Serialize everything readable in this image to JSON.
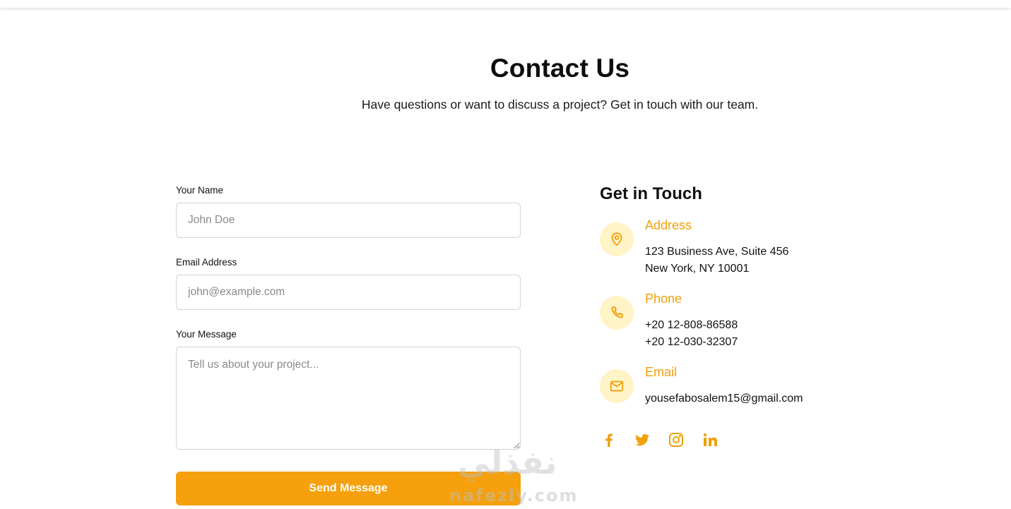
{
  "header": {
    "title": "Contact Us",
    "subtitle": "Have questions or want to discuss a project? Get in touch with our team."
  },
  "form": {
    "name": {
      "label": "Your Name",
      "placeholder": "John Doe",
      "value": ""
    },
    "email": {
      "label": "Email Address",
      "placeholder": "john@example.com",
      "value": ""
    },
    "message": {
      "label": "Your Message",
      "placeholder": "Tell us about your project...",
      "value": ""
    },
    "submit_label": "Send Message"
  },
  "contact": {
    "heading": "Get in Touch",
    "address": {
      "title": "Address",
      "lines": [
        "123 Business Ave, Suite 456",
        "New York, NY 10001"
      ],
      "icon": "map-pin-icon"
    },
    "phone": {
      "title": "Phone",
      "lines": [
        "+20 12-808-86588",
        "+20 12-030-32307"
      ],
      "icon": "phone-icon"
    },
    "email": {
      "title": "Email",
      "lines": [
        "yousefabosalem15@gmail.com"
      ],
      "icon": "mail-icon"
    }
  },
  "socials": [
    {
      "name": "facebook",
      "icon": "facebook-icon"
    },
    {
      "name": "twitter",
      "icon": "twitter-icon"
    },
    {
      "name": "instagram",
      "icon": "instagram-icon"
    },
    {
      "name": "linkedin",
      "icon": "linkedin-icon"
    }
  ],
  "watermark": {
    "arabic": "نفذلي",
    "latin": "nafezly.com"
  },
  "colors": {
    "accent": "#f5a00c",
    "accent_text": "#f0a00a",
    "icon_bg": "#fff3c8",
    "border": "#d4d4d4"
  }
}
